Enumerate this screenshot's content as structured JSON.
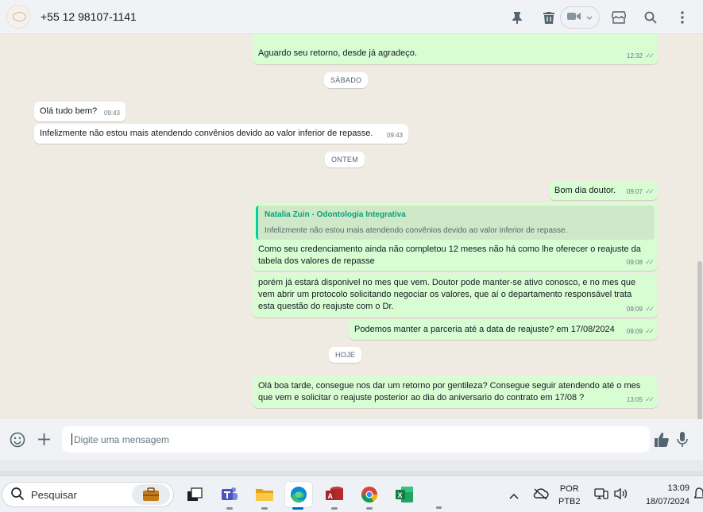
{
  "header": {
    "contact_name": "+55 12 98107-1141",
    "icons": [
      "pin-icon",
      "delete-icon",
      "video-call-icon",
      "store-icon",
      "search-icon",
      "menu-icon"
    ]
  },
  "messages": [
    {
      "type": "out",
      "text": "Aguardo seu retorno, desde já agradeço.",
      "time": "12:32"
    },
    {
      "type": "day",
      "text": "SÁBADO"
    },
    {
      "type": "in",
      "text": "Olá tudo bem?",
      "time": "09:43"
    },
    {
      "type": "in",
      "text": "Infelizmente não estou mais atendendo convênios devido ao valor inferior de repasse.",
      "time": "09:43"
    },
    {
      "type": "day",
      "text": "ONTEM"
    },
    {
      "type": "out",
      "text": "Bom dia doutor.",
      "time": "09:07"
    },
    {
      "type": "out",
      "quote_author": "Natalia Zuin - Odontologia Integrativa",
      "quote_text": "Infelizmente não estou mais atendendo convênios devido ao valor inferior de repasse.",
      "text": "Como seu credenciamento ainda não completou 12 meses não há como lhe oferecer o reajuste da tabela dos valores de repasse",
      "time": "09:08"
    },
    {
      "type": "out",
      "text": "porém já estará disponivel no mes que vem. Doutor pode manter-se ativo conosco, e no mes que vem abrir um protocolo solicitando negociar os valores, que aí o departamento responsável trata esta questão do reajuste com o Dr.",
      "time": "09:09"
    },
    {
      "type": "out",
      "text": "Podemos manter a parceria até a data de reajuste? em 17/08/2024",
      "time": "09:09"
    },
    {
      "type": "day",
      "text": "HOJE"
    },
    {
      "type": "out",
      "text": "Olá boa tarde, consegue nos dar um retorno por gentileza? Consegue seguir atendendo até o mes que vem e solicitar o reajuste posterior ao dia do aniversario do contrato em 17/08 ?",
      "time": "13:05"
    }
  ],
  "composer": {
    "placeholder": "Digite uma mensagem"
  },
  "taskbar": {
    "search_placeholder": "Pesquisar",
    "apps": [
      "briefcase-icon",
      "task-view-icon",
      "teams-icon",
      "file-explorer-icon",
      "edge-icon",
      "access-icon",
      "chrome-icon",
      "excel-icon"
    ],
    "lang_top": "POR",
    "lang_bottom": "PTB2",
    "time": "13:09",
    "date": "18/07/2024"
  }
}
